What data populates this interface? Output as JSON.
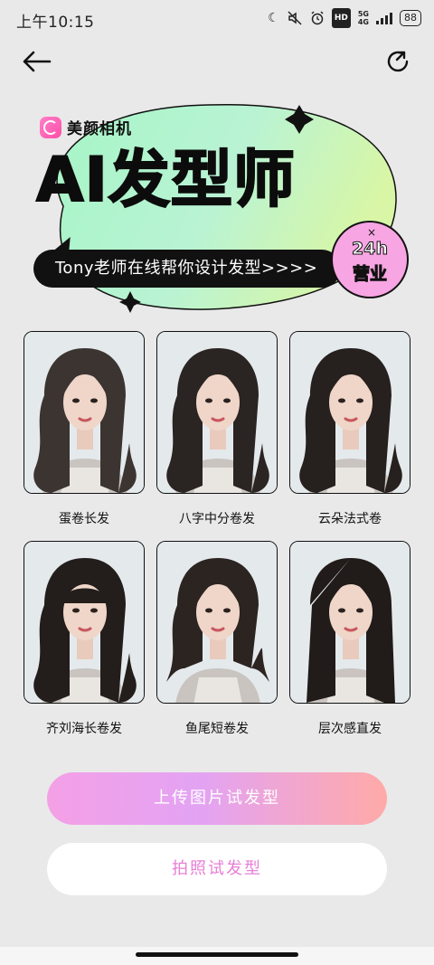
{
  "status_bar": {
    "time": "上午10:15",
    "hd": "HD",
    "net_top": "5G",
    "net_bottom": "4G",
    "battery": "88"
  },
  "nav": {
    "back_icon": "arrow-left-icon",
    "share_icon": "refresh-share-icon"
  },
  "banner": {
    "brand_name": "美颜相机",
    "headline": "AI发型师",
    "tagline": "Tony老师在线帮你设计发型>>>>",
    "badge_top": "24h",
    "badge_bottom": "营业",
    "badge_mark": "×",
    "colors": {
      "blob_start": "#a8f7c6",
      "blob_end": "#d8f5a8",
      "badge": "#f8a5e4"
    }
  },
  "hairstyles": [
    {
      "label": "蛋卷长发",
      "hair_color": "#3b3431",
      "style": "curly-long"
    },
    {
      "label": "八字中分卷发",
      "hair_color": "#2a2422",
      "style": "middle-part-wave"
    },
    {
      "label": "云朵法式卷",
      "hair_color": "#26201e",
      "style": "cloud-french-curl"
    },
    {
      "label": "齐刘海长卷发",
      "hair_color": "#231d1b",
      "style": "bangs-long-curl"
    },
    {
      "label": "鱼尾短卷发",
      "hair_color": "#2c2421",
      "style": "fishtail-short-curl"
    },
    {
      "label": "层次感直发",
      "hair_color": "#211b1a",
      "style": "layered-straight"
    }
  ],
  "actions": {
    "upload_label": "上传图片试发型",
    "photo_label": "拍照试发型"
  }
}
